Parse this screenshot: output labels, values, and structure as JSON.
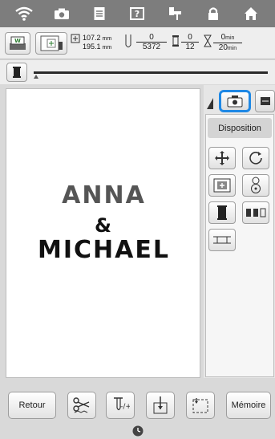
{
  "toolbar": {
    "icons": [
      "wifi-icon",
      "camera-icon",
      "document-icon",
      "help-icon",
      "sewing-icon",
      "lock-icon",
      "home-icon"
    ]
  },
  "info": {
    "width_value": "107.2",
    "height_value": "195.1",
    "unit_mm": "mm",
    "stitch_current": "0",
    "stitch_total": "5372",
    "color_current": "0",
    "color_total": "12",
    "time_current": "0",
    "time_total": "20",
    "unit_min": "min"
  },
  "progress": {
    "fraction": 0.0
  },
  "design": {
    "line1": "ANNA",
    "line2": "&",
    "line3": "MICHAEL"
  },
  "panel": {
    "disposition_label": "Disposition",
    "active_tab": "camera-tab"
  },
  "bottom": {
    "back_label": "Retour",
    "memory_label": "Mémoire"
  },
  "colors": {
    "accent": "#1e88e5",
    "topbar": "#7d7d7d"
  }
}
